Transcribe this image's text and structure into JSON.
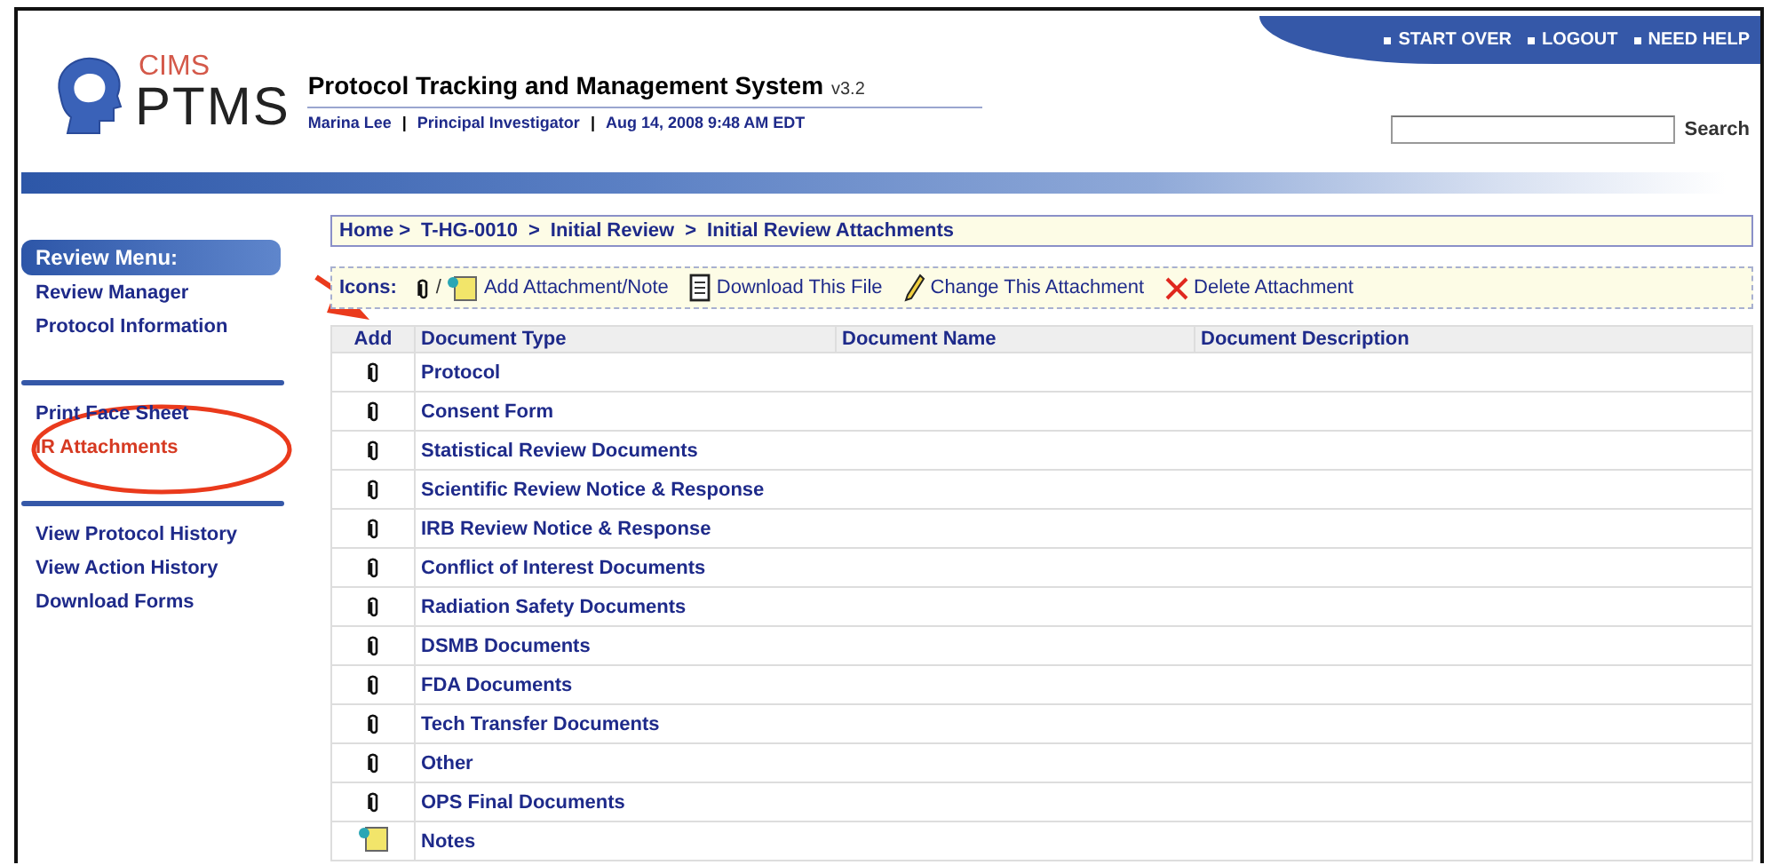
{
  "logo": {
    "top": "CIMS",
    "bottom": "PTMS"
  },
  "header": {
    "title": "Protocol Tracking and Management System",
    "version": "v3.2",
    "user": "Marina Lee",
    "role": "Principal Investigator",
    "datetime": "Aug 14, 2008 9:48 AM EDT",
    "separator": "|"
  },
  "top_links": [
    "START OVER",
    "LOGOUT",
    "NEED HELP"
  ],
  "search": {
    "button": "Search"
  },
  "sidebar": {
    "title": "Review Menu:",
    "groups": [
      {
        "items": [
          {
            "label": "Review Manager",
            "selected": false
          },
          {
            "label": "Protocol Information",
            "selected": false
          }
        ]
      },
      {
        "items": [
          {
            "label": "Print Face Sheet",
            "selected": false
          },
          {
            "label": "IR Attachments",
            "selected": true
          }
        ]
      },
      {
        "items": [
          {
            "label": "View Protocol History",
            "selected": false
          },
          {
            "label": "View Action History",
            "selected": false
          },
          {
            "label": "Download Forms",
            "selected": false
          }
        ]
      }
    ]
  },
  "breadcrumb": [
    "Home >",
    "T-HG-0010",
    ">",
    "Initial Review",
    ">",
    "Initial Review Attachments"
  ],
  "legend": {
    "label": "Icons:",
    "separator": "/",
    "items": [
      {
        "kind": "add",
        "label": "Add Attachment/Note"
      },
      {
        "kind": "download",
        "label": "Download This File"
      },
      {
        "kind": "change",
        "label": "Change This Attachment"
      },
      {
        "kind": "delete",
        "label": "Delete Attachment"
      }
    ]
  },
  "table": {
    "columns": [
      "Add",
      "Document Type",
      "Document Name",
      "Document Description"
    ],
    "rows": [
      {
        "kind": "attachment",
        "type": "Protocol"
      },
      {
        "kind": "attachment",
        "type": "Consent Form"
      },
      {
        "kind": "attachment",
        "type": "Statistical Review Documents"
      },
      {
        "kind": "attachment",
        "type": "Scientific Review Notice & Response"
      },
      {
        "kind": "attachment",
        "type": "IRB Review Notice & Response"
      },
      {
        "kind": "attachment",
        "type": "Conflict of Interest Documents"
      },
      {
        "kind": "attachment",
        "type": "Radiation Safety Documents"
      },
      {
        "kind": "attachment",
        "type": "DSMB Documents"
      },
      {
        "kind": "attachment",
        "type": "FDA Documents"
      },
      {
        "kind": "attachment",
        "type": "Tech Transfer Documents"
      },
      {
        "kind": "attachment",
        "type": "Other"
      },
      {
        "kind": "attachment",
        "type": "OPS Final Documents"
      },
      {
        "kind": "note",
        "type": "Notes"
      }
    ]
  }
}
